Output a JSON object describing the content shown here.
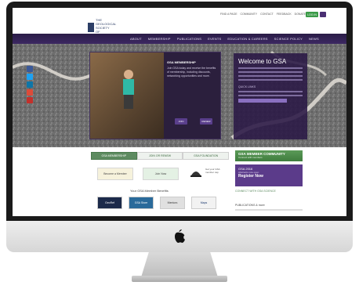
{
  "header": {
    "logo_text": "THE GEOLOGICAL SOCIETY OF AMERICA",
    "utility_links": [
      "FIND A PAGE",
      "COMMUNITY",
      "CONTACT",
      "FEEDBACK",
      "DONATE"
    ],
    "login_label": "LOG IN"
  },
  "nav": {
    "items": [
      "ABOUT",
      "MEMBERSHIP",
      "PUBLICATIONS",
      "EVENTS",
      "EDUCATION & CAREERS",
      "SCIENCE POLICY",
      "NEWS"
    ]
  },
  "hero": {
    "feature_title": "GSA MEMBERSHIP",
    "feature_text": "Join GSA today and receive the benefits of membership, including discounts, networking opportunities and more.",
    "feature_buttons": [
      "JOIN",
      "RENEW"
    ],
    "welcome_title": "Welcome to GSA",
    "welcome_sub": "QUICK LINKS",
    "social_colors": [
      "#3b5998",
      "#1da1f2",
      "#0e76a8",
      "#dd4b39",
      "#c4302b"
    ]
  },
  "content": {
    "tabs": [
      "GSA MEMBERSHIP",
      "JOIN OR RENEW",
      "GSA FOUNDATION"
    ],
    "boxes": [
      "Become a Member",
      "Join Now"
    ],
    "cap_text": "Get your GSA member cap",
    "benefits_title": "Your GSA Member Benefits",
    "partners": [
      "GeoRef",
      "GSA Store",
      "Mentors",
      "Maps"
    ],
    "partner_colors": [
      "#1c2a4a",
      "#2a6a9a",
      "#e0e0e0",
      "#f2f2f2"
    ]
  },
  "sidebar": {
    "green_title": "GSA MEMBER COMMUNITY",
    "green_sub": "Connect with members",
    "purple_a": "GSA 2016",
    "purple_b": "Abstracts now open",
    "purple_c": "Register Now",
    "link": "CONNECT WITH GSA SCIENCE",
    "head": "PUBLICATIONS & more"
  }
}
